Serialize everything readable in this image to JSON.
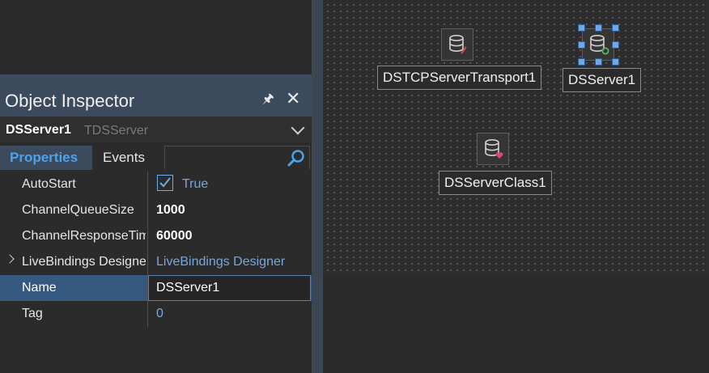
{
  "inspector": {
    "title": "Object Inspector",
    "pin_icon": "pin-icon",
    "close_icon": "close-icon",
    "selected_object": {
      "name": "DSServer1",
      "type": "TDSServer"
    },
    "tabs": [
      {
        "label": "Properties",
        "active": true
      },
      {
        "label": "Events",
        "active": false
      }
    ],
    "search": {
      "value": "",
      "placeholder": ""
    },
    "properties": [
      {
        "name": "AutoStart",
        "value": "True"
      },
      {
        "name": "ChannelQueueSize",
        "value": "1000"
      },
      {
        "name": "ChannelResponseTimeout",
        "value": "60000"
      },
      {
        "name": "LiveBindings Designer",
        "value": "LiveBindings Designer"
      },
      {
        "name": "Name",
        "value": "DSServer1"
      },
      {
        "name": "Tag",
        "value": "0"
      }
    ]
  },
  "designer": {
    "components": [
      {
        "label": "DSTCPServerTransport1",
        "icon": "database-transport-icon"
      },
      {
        "label": "DSServer1",
        "icon": "database-server-icon",
        "selected": true
      },
      {
        "label": "DSServerClass1",
        "icon": "database-class-icon"
      }
    ]
  },
  "colors": {
    "accent": "#4aa3f0",
    "selection": "#35587f",
    "titlebar": "#3b4a5c",
    "value_link": "#7aa7d8"
  }
}
